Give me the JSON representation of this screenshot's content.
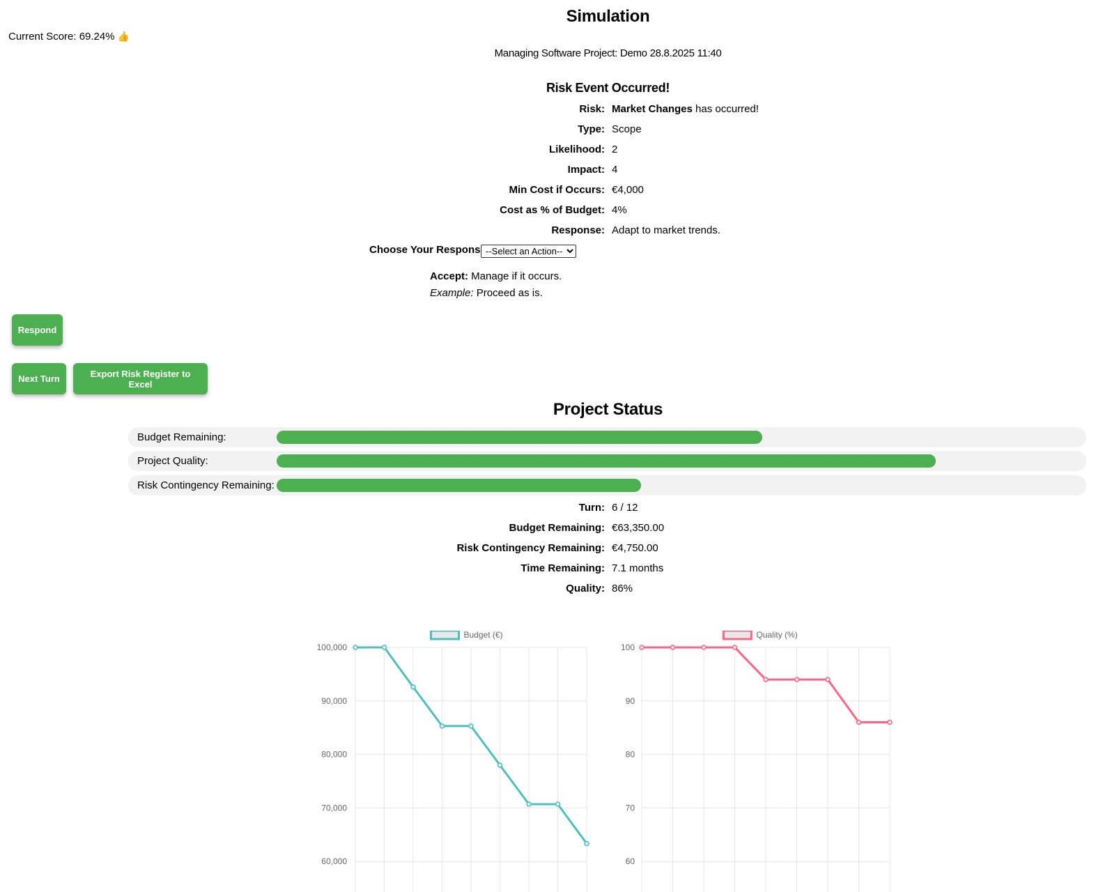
{
  "header": {
    "title": "Simulation",
    "subtitle": "Managing Software Project: Demo 28.8.2025 11:40",
    "score_label": "Current Score: 69.24%",
    "score_emoji": "👍"
  },
  "risk_event": {
    "heading": "Risk Event Occurred!",
    "risk_label": "Risk:",
    "risk_name": "Market Changes",
    "risk_suffix": " has occurred!",
    "fields": [
      {
        "label": "Type:",
        "value": "Scope"
      },
      {
        "label": "Likelihood:",
        "value": "2"
      },
      {
        "label": "Impact:",
        "value": "4"
      },
      {
        "label": "Min Cost if Occurs:",
        "value": "€4,000"
      },
      {
        "label": "Cost as % of Budget:",
        "value": "4%"
      },
      {
        "label": "Response:",
        "value": "Adapt to market trends."
      }
    ],
    "choose_label": "Choose Your Response:",
    "select_value": "--Select an Action--",
    "accept_bold": "Accept:",
    "accept_text": " Manage if it occurs.",
    "example_italic": "Example:",
    "example_text": " Proceed as is."
  },
  "buttons": {
    "respond": "Respond",
    "next_turn": "Next Turn",
    "export": "Export Risk Register to Excel"
  },
  "status": {
    "heading": "Project Status",
    "bars": [
      {
        "label": "Budget Remaining:",
        "fraction": 0.6335
      },
      {
        "label": "Project Quality:",
        "fraction": 0.86
      },
      {
        "label": "Risk Contingency Remaining:",
        "fraction": 0.475
      }
    ],
    "fields": [
      {
        "label": "Turn:",
        "value": "6 / 12"
      },
      {
        "label": "Budget Remaining:",
        "value": "€63,350.00"
      },
      {
        "label": "Risk Contingency Remaining:",
        "value": "€4,750.00"
      },
      {
        "label": "Time Remaining:",
        "value": "7.1 months"
      },
      {
        "label": "Quality:",
        "value": "86%"
      }
    ]
  },
  "colors": {
    "accent": "#4CAF50",
    "budget_line": "#4BC0C0",
    "quality_line": "#FF6384"
  },
  "chart_data": [
    {
      "type": "line",
      "legend": [
        "Budget (€)"
      ],
      "series": [
        {
          "name": "Budget (€)",
          "values": [
            100000,
            100000,
            92600,
            85300,
            85300,
            78000,
            70700,
            70700,
            63350
          ]
        }
      ],
      "yticks": [
        "100,000",
        "90,000",
        "80,000",
        "70,000",
        "60,000"
      ],
      "ylim_visible": [
        60000,
        100000
      ],
      "legend_position": "top",
      "grid": true
    },
    {
      "type": "line",
      "legend": [
        "Quality (%)"
      ],
      "series": [
        {
          "name": "Quality (%)",
          "values": [
            100,
            100,
            100,
            100,
            94,
            94,
            94,
            86,
            86
          ]
        }
      ],
      "yticks": [
        "100",
        "90",
        "80",
        "70",
        "60"
      ],
      "ylim_visible": [
        60,
        100
      ],
      "legend_position": "top",
      "grid": true
    }
  ]
}
